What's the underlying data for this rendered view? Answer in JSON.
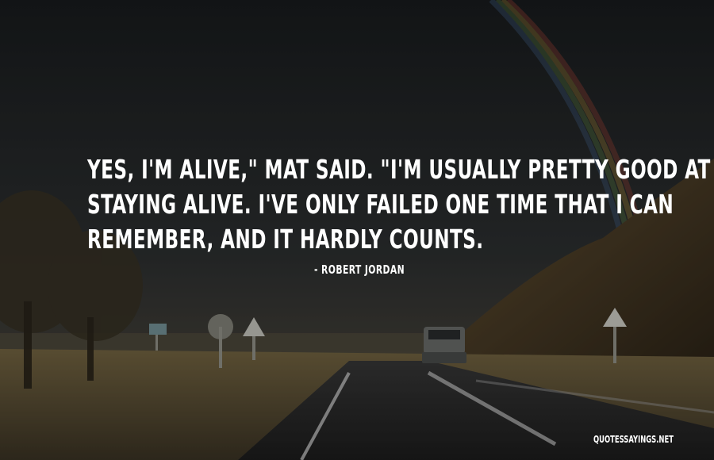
{
  "quote": {
    "lines": [
      "Yes, I'm alive,\" Mat said. \"I'm usually pretty good at",
      "staying alive. I've only failed one time that I can",
      "remember, and it hardly counts."
    ],
    "author": "- Robert Jordan"
  },
  "watermark": "QUOTESSAYINGS.NET",
  "colors": {
    "text": "#ffffff",
    "sky": "#24282a",
    "ground": "#6b5d3e"
  }
}
